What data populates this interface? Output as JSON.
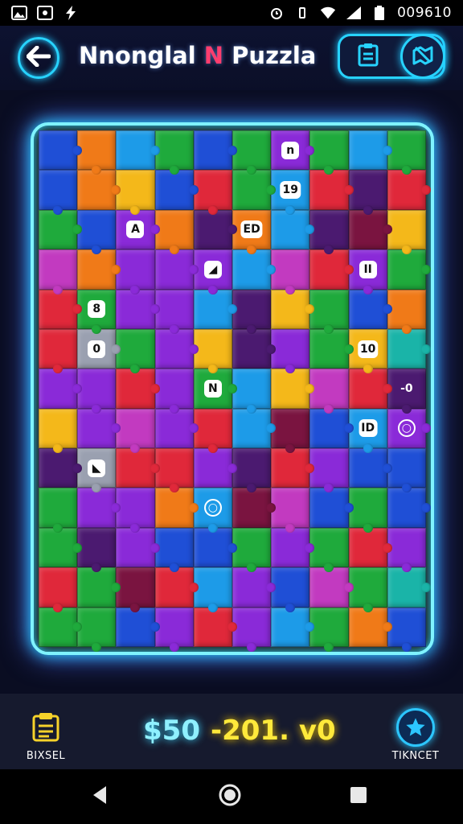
{
  "status_bar": {
    "time": "009610",
    "left_icons": [
      "gallery-icon",
      "app-icon",
      "bolt-icon"
    ],
    "right_icons": [
      "alarm-icon",
      "vibrate-icon",
      "wifi-icon",
      "signal-icon",
      "battery-icon"
    ]
  },
  "header": {
    "title_part1": "Nnonglal ",
    "title_accent": "N",
    "title_part2": " Puzzla",
    "back_icon": "arrow-left-icon",
    "pill_left_icon": "clipboard-icon",
    "pill_right_icon": "map-icon",
    "accent_color": "#27d3ff"
  },
  "board": {
    "columns": 10,
    "rows": 13,
    "palette": {
      "G": "#1faa3c",
      "B": "#1f4fd6",
      "P": "#8a2ad8",
      "R": "#e0283a",
      "O": "#f07a18",
      "Y": "#f4b81a",
      "C": "#1d9be8",
      "M": "#c23ac0",
      "D": "#4b1a70",
      "K": "#7a1440",
      "T": "#1ab4a8",
      "S": "#9aa0b0"
    },
    "pieces": [
      "BOCGBGPGCG",
      "BOYBRGCRDR",
      "GBPODOCDKY",
      "MOPPPCMRPG",
      "RGPPCDYGBO",
      "RSGPYDPGYT",
      "PPRPGCYMRD",
      "YPMPRCKBCP",
      "DSRRPDRPBB",
      "GPPOCKMBGB",
      "GDPBBGPGRP",
      "RGKRCPBMGT",
      "GGBPRPCGOB"
    ],
    "markers": [
      {
        "row": 0,
        "col": 6,
        "text": "n"
      },
      {
        "row": 1,
        "col": 6,
        "text": "19"
      },
      {
        "row": 2,
        "col": 2,
        "text": "A"
      },
      {
        "row": 2,
        "col": 5,
        "text": "ED"
      },
      {
        "row": 3,
        "col": 4,
        "text": "◢"
      },
      {
        "row": 3,
        "col": 8,
        "text": "II"
      },
      {
        "row": 4,
        "col": 1,
        "text": "8"
      },
      {
        "row": 5,
        "col": 1,
        "text": "0"
      },
      {
        "row": 5,
        "col": 8,
        "text": "10"
      },
      {
        "row": 6,
        "col": 4,
        "text": "N"
      },
      {
        "row": 6,
        "col": 9,
        "text": "-0"
      },
      {
        "row": 7,
        "col": 8,
        "text": "ID"
      },
      {
        "row": 7,
        "col": 9,
        "text": "○"
      },
      {
        "row": 8,
        "col": 1,
        "text": "◣"
      },
      {
        "row": 9,
        "col": 4,
        "text": "○"
      }
    ]
  },
  "bottom": {
    "left_label": "BIXSEL",
    "left_icon": "clipboard-icon",
    "money": "$50",
    "score": "-201. v0",
    "right_label": "TIKNCET",
    "right_icon": "star-icon"
  },
  "navbar": {
    "icons": [
      "back-triangle-icon",
      "home-circle-icon",
      "recents-square-icon"
    ]
  }
}
